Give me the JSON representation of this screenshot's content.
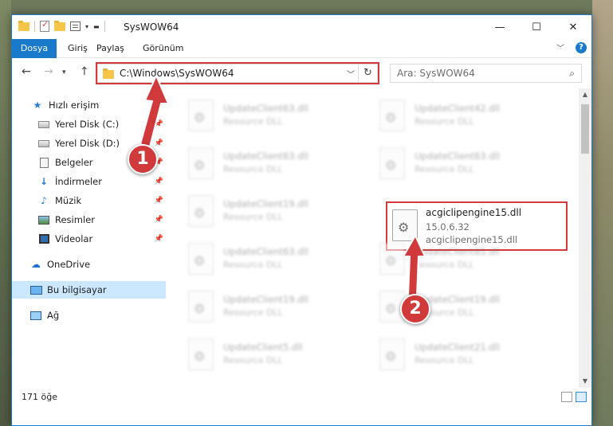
{
  "window": {
    "title": "SysWOW64",
    "caption": {
      "minimize": "—",
      "maximize": "☐",
      "close": "✕"
    }
  },
  "ribbon": {
    "tabs": [
      "Dosya",
      "Giriş",
      "Paylaş",
      "Görünüm"
    ],
    "accent": "#1979ca"
  },
  "address": {
    "path": "C:\\Windows\\SysWOW64",
    "search_placeholder": "Ara: SysWOW64"
  },
  "navigation": {
    "quick_access": "Hızlı erişim",
    "items": [
      {
        "label": "Yerel Disk (C:)",
        "icon": "drive-icon",
        "pinned": true
      },
      {
        "label": "Yerel Disk (D:)",
        "icon": "drive-icon",
        "pinned": true
      },
      {
        "label": "Belgeler",
        "icon": "documents-icon",
        "pinned": true
      },
      {
        "label": "İndirmeler",
        "icon": "downloads-icon",
        "pinned": true
      },
      {
        "label": "Müzik",
        "icon": "music-icon",
        "pinned": true
      },
      {
        "label": "Resimler",
        "icon": "pictures-icon",
        "pinned": true
      },
      {
        "label": "Videolar",
        "icon": "videos-icon",
        "pinned": true
      }
    ],
    "onedrive": "OneDrive",
    "this_pc": "Bu bilgisayar",
    "network": "Ağ"
  },
  "files": [
    {
      "name": "UpdateClient63.dll",
      "desc": "Resource DLL",
      "blurred": true
    },
    {
      "name": "UpdateClient42.dll",
      "desc": "Resource DLL",
      "blurred": true
    },
    {
      "name": "UpdateClient63.dll",
      "desc": "Resource DLL",
      "blurred": true
    },
    {
      "name": "UpdateClient63.dll",
      "desc": "Resource DLL",
      "blurred": true
    },
    {
      "name": "UpdateClient19.dll",
      "desc": "Resource DLL",
      "blurred": true
    },
    {
      "name": "acgiclipengine15.dll",
      "version": "15.0.6.32",
      "desc": "acgiclipengine15.dll",
      "blurred": false
    },
    {
      "name": "UpdateClient63.dll",
      "desc": "Resource DLL",
      "blurred": true
    },
    {
      "name": "UpdateClient65.dll",
      "desc": "Resource DLL",
      "blurred": true
    },
    {
      "name": "UpdateClient19.dll",
      "desc": "Resource DLL",
      "blurred": true
    },
    {
      "name": "UpdateClient19.dll",
      "desc": "Resource DLL",
      "blurred": true
    },
    {
      "name": "UpdateClient5.dll",
      "desc": "Resource DLL",
      "blurred": true
    },
    {
      "name": "UpdateClient21.dll",
      "desc": "Resource DLL",
      "blurred": true
    }
  ],
  "status": {
    "count": "171 öğe"
  },
  "annotations": [
    {
      "label": "1"
    },
    {
      "label": "2"
    }
  ],
  "colors": {
    "highlight": "#d6393a",
    "selection": "#cce8ff"
  }
}
